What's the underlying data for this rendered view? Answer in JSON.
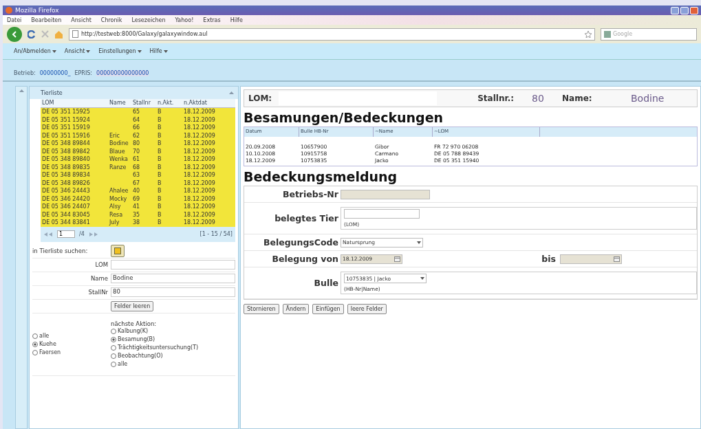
{
  "window": {
    "title": "Mozilla Firefox"
  },
  "menu": [
    "Datei",
    "Bearbeiten",
    "Ansicht",
    "Chronik",
    "Lesezeichen",
    "Yahoo!",
    "Extras",
    "Hilfe"
  ],
  "address_bar": {
    "value": "http://testweb:8000/Galaxy/galaxywindow.aul"
  },
  "search": {
    "placeholder": "Google"
  },
  "app_menu": [
    "An/Abmelden",
    "Ansicht",
    "Einstellungen",
    "Hilfe"
  ],
  "info": {
    "betrieb_label": "Betrieb:",
    "betrieb": "00000000_",
    "epris_label": "EPRIS:",
    "epris": "000000000000000"
  },
  "tierliste": {
    "title": "Tierliste",
    "columns": [
      "LOM",
      "Name",
      "Stallnr",
      "n.Akt.",
      "n.Aktdat"
    ],
    "rows": [
      {
        "lom": "DE 05 351 15925",
        "stallnr": "65",
        "akt": "B",
        "datum": "18.12.2009"
      },
      {
        "lom": "DE 05 351 15924",
        "stallnr": "64",
        "akt": "B",
        "datum": "18.12.2009"
      },
      {
        "lom": "DE 05 351 15919",
        "stallnr": "66",
        "akt": "B",
        "datum": "18.12.2009"
      },
      {
        "lom": "DE 05 351 15916",
        "name": "Eric",
        "stallnr": "62",
        "akt": "B",
        "datum": "18.12.2009"
      },
      {
        "lom": "DE 05 348 89844",
        "name": "Bodine",
        "stallnr": "80",
        "akt": "B",
        "datum": "18.12.2009"
      },
      {
        "lom": "DE 05 348 89842",
        "name": "Blaue",
        "stallnr": "70",
        "akt": "B",
        "datum": "18.12.2009"
      },
      {
        "lom": "DE 05 348 89840",
        "name": "Wenka",
        "stallnr": "61",
        "akt": "B",
        "datum": "18.12.2009"
      },
      {
        "lom": "DE 05 348 89835",
        "name": "Ranze",
        "stallnr": "68",
        "akt": "B",
        "datum": "18.12.2009"
      },
      {
        "lom": "DE 05 348 89834",
        "stallnr": "63",
        "akt": "B",
        "datum": "18.12.2009"
      },
      {
        "lom": "DE 05 348 89826",
        "stallnr": "67",
        "akt": "B",
        "datum": "18.12.2009"
      },
      {
        "lom": "DE 05 346 24443",
        "name": "Ahalee",
        "stallnr": "40",
        "akt": "B",
        "datum": "18.12.2009"
      },
      {
        "lom": "DE 05 346 24420",
        "name": "Mocky",
        "stallnr": "69",
        "akt": "B",
        "datum": "18.12.2009"
      },
      {
        "lom": "DE 05 346 24407",
        "name": "Alsy",
        "stallnr": "41",
        "akt": "B",
        "datum": "18.12.2009"
      },
      {
        "lom": "DE 05 344 83045",
        "name": "Resa",
        "stallnr": "35",
        "akt": "B",
        "datum": "18.12.2009"
      },
      {
        "lom": "DE 05 344 83841",
        "name": "July",
        "stallnr": "38",
        "akt": "B",
        "datum": "18.12.2009"
      }
    ],
    "pager": {
      "page": "1",
      "pages": "/4",
      "range": "[1 - 15 / 54]"
    }
  },
  "suche": {
    "label": "in Tierliste suchen:",
    "fields": [
      {
        "label": "LOM"
      },
      {
        "label": "Name",
        "value": "Bodine"
      },
      {
        "label": "StallNr",
        "value": "80"
      }
    ],
    "clear_button": "Felder leeren",
    "gruppe": [
      {
        "label": "alle",
        "selected": false
      },
      {
        "label": "Kuehe",
        "selected": true
      },
      {
        "label": "Faersen",
        "selected": false
      }
    ],
    "aktion_label": "nächste Aktion:",
    "aktion": [
      {
        "label": "Kalbung(K)",
        "selected": false
      },
      {
        "label": "Besamung(B)",
        "selected": true
      },
      {
        "label": "Trächtigkeitsuntersuchung(T)",
        "selected": false
      },
      {
        "label": "Beobachtung(O)",
        "selected": false
      },
      {
        "label": "alle",
        "selected": false
      }
    ]
  },
  "kopf": {
    "lom_label": "LOM:",
    "stallnr_label": "Stallnr.:",
    "stallnr": "80",
    "name_label": "Name:",
    "name": "Bodine"
  },
  "besamungen": {
    "title": "Besamungen/Bedeckungen",
    "columns": [
      "Datum",
      "Bulle HB-Nr",
      "~Name",
      "~LOM"
    ],
    "rows": [
      [
        "20.09.2008",
        "10657900",
        "Gibor",
        "FR 72 970 06208"
      ],
      [
        "10.10.2008",
        "10915758",
        "Carmano",
        "DE 05 788 89439"
      ],
      [
        "18.12.2009",
        "10753835",
        "Jacko",
        "DE 05 351 15940"
      ]
    ]
  },
  "meldung": {
    "title": "Bedeckungsmeldung",
    "betriebsnr_label": "Betriebs-Nr",
    "tier_label": "belegtes Tier",
    "tier_hint": "(LOM)",
    "code_label": "BelegungsCode",
    "code": "Natursprung",
    "von_label": "Belegung von",
    "von": "18.12.2009",
    "bis_label": "bis",
    "bulle_label": "Bulle",
    "bulle": "10753835 | Jacko",
    "bulle_hint": "(HB-Nr|Name)",
    "buttons": [
      "Stornieren",
      "Ändern",
      "Einfügen",
      "leere Felder"
    ]
  }
}
